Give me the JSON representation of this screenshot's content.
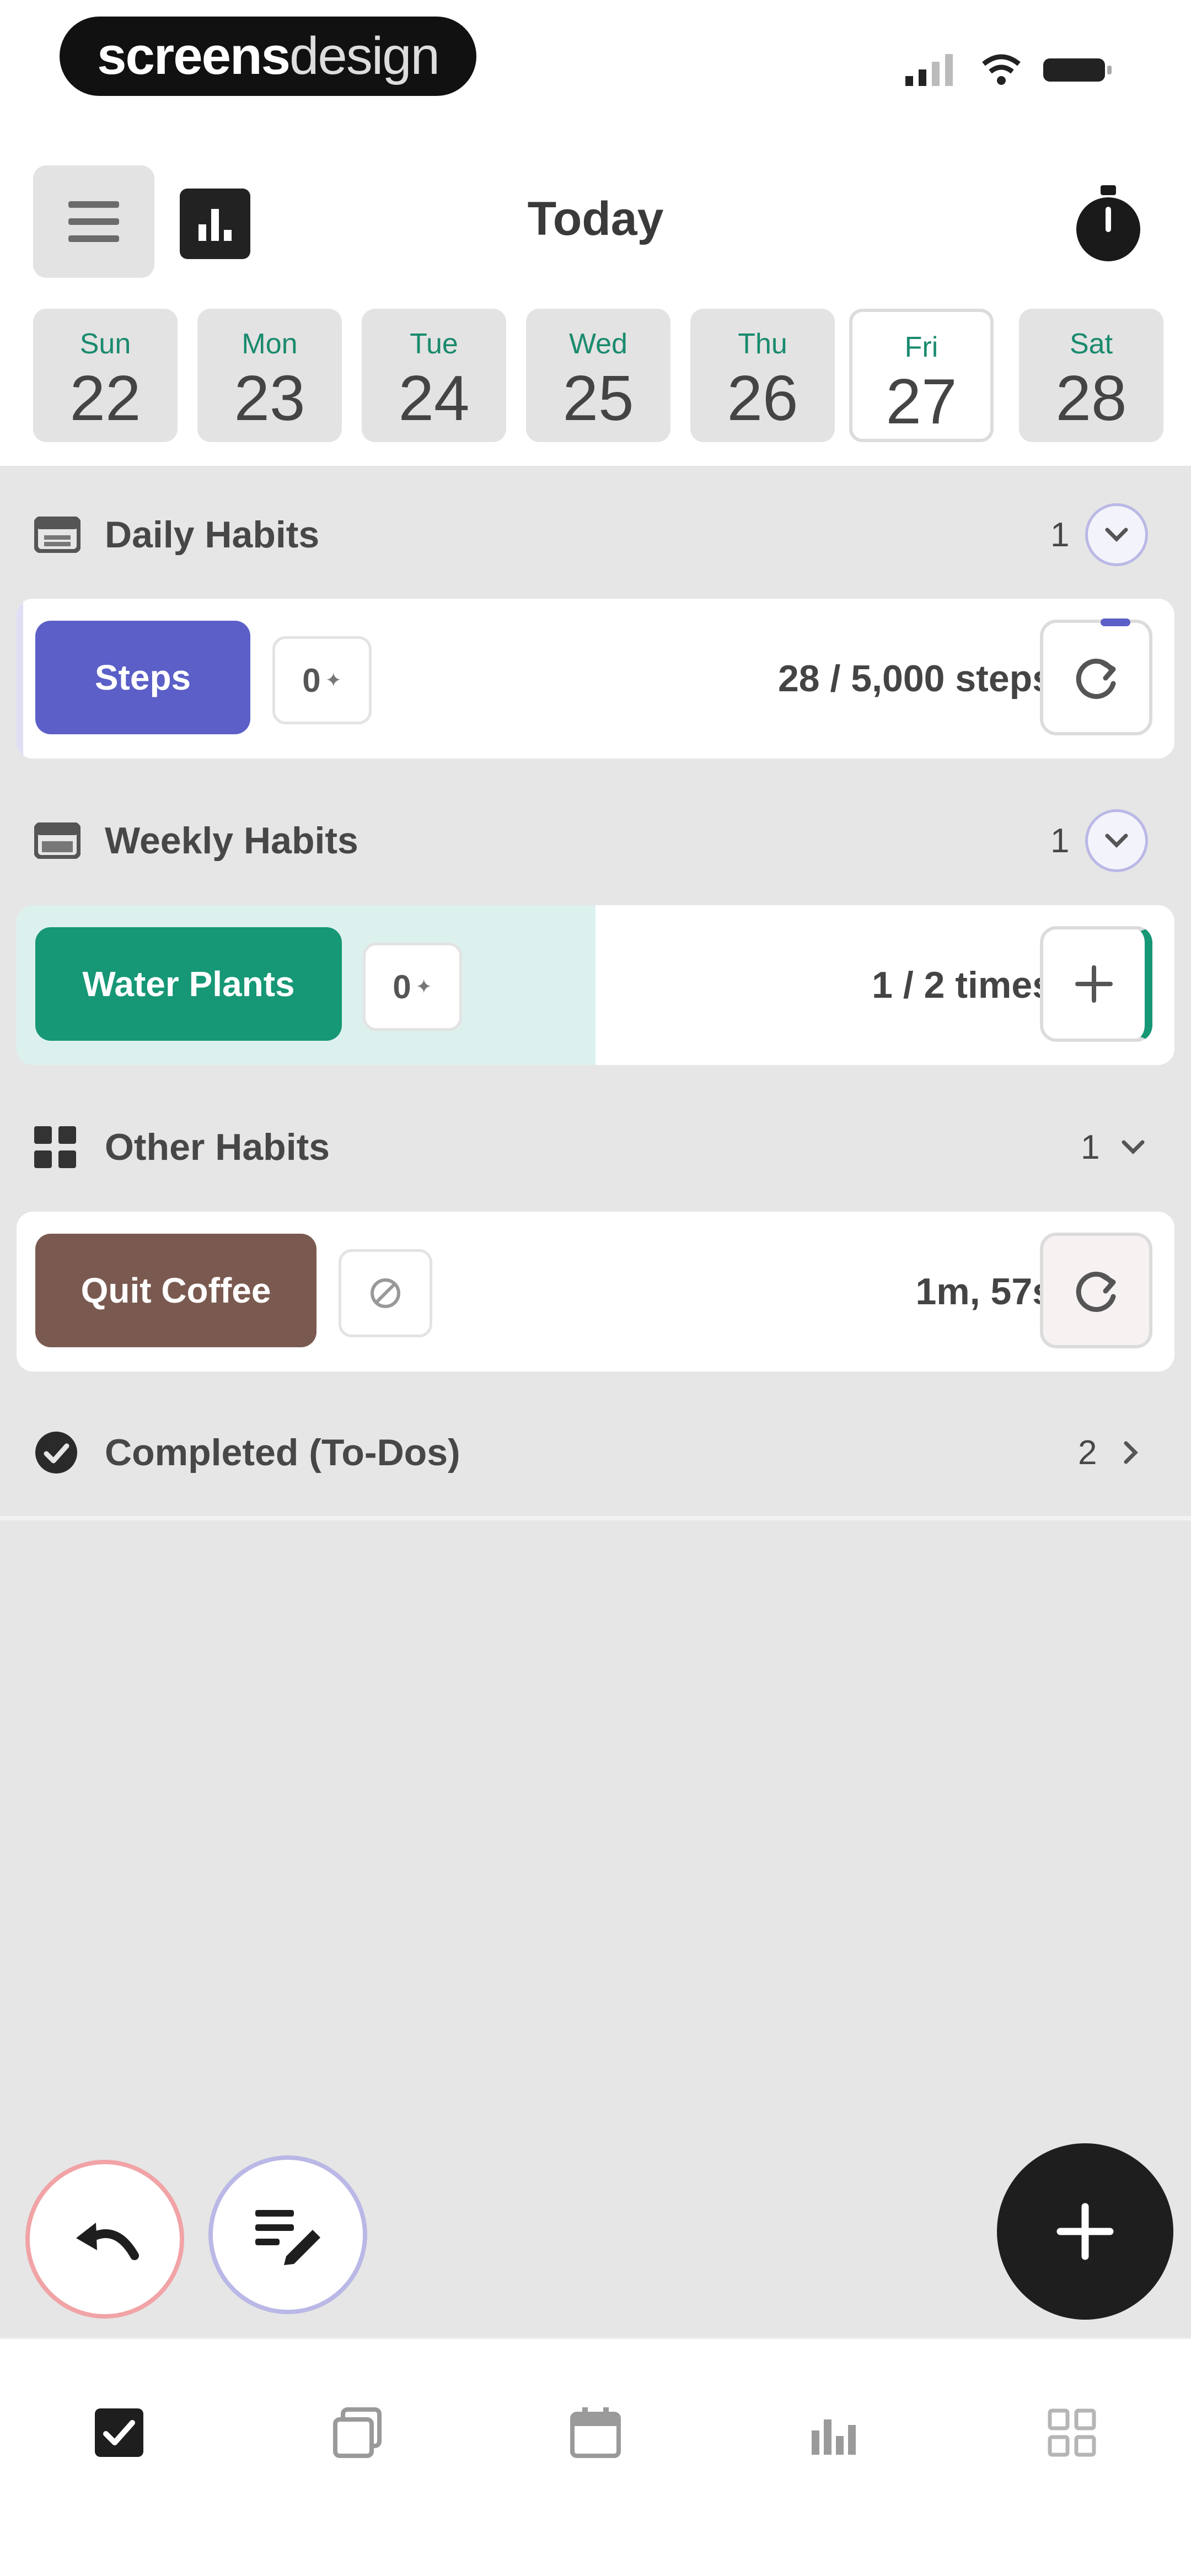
{
  "status_bar": {
    "brand_part1": "screens",
    "brand_part2": "design"
  },
  "header": {
    "title": "Today",
    "menu_icon": "hamburger-menu-icon",
    "stats_icon": "bar-chart-icon",
    "timer_icon": "stopwatch-icon"
  },
  "week": [
    {
      "name": "Sun",
      "date": "22",
      "selected": false
    },
    {
      "name": "Mon",
      "date": "23",
      "selected": false
    },
    {
      "name": "Tue",
      "date": "24",
      "selected": false
    },
    {
      "name": "Wed",
      "date": "25",
      "selected": false
    },
    {
      "name": "Thu",
      "date": "26",
      "selected": false
    },
    {
      "name": "Fri",
      "date": "27",
      "selected": true
    },
    {
      "name": "Sat",
      "date": "28",
      "selected": false
    }
  ],
  "sections": {
    "daily": {
      "label": "Daily Habits",
      "count": "1",
      "habit": {
        "name": "Steps",
        "streak": "0",
        "progress": "28 / 5,000 steps",
        "progress_fraction": 0.0056,
        "color": "#5b5fc7",
        "action_icon": "refresh-icon"
      }
    },
    "weekly": {
      "label": "Weekly Habits",
      "count": "1",
      "habit": {
        "name": "Water Plants",
        "streak": "0",
        "progress": "1 / 2 times",
        "progress_fraction": 0.5,
        "color": "#169776",
        "action_icon": "plus-icon"
      }
    },
    "other": {
      "label": "Other Habits",
      "count": "1",
      "habit": {
        "name": "Quit Coffee",
        "timer": "1m, 57s",
        "color": "#7a5a50",
        "action_icon": "refresh-icon"
      }
    },
    "completed": {
      "label": "Completed (To-Dos)",
      "count": "2"
    }
  },
  "bottom_nav": [
    {
      "name": "nav-today",
      "icon": "checkbox-icon",
      "active": true
    },
    {
      "name": "nav-habits",
      "icon": "stack-icon",
      "active": false
    },
    {
      "name": "nav-calendar",
      "icon": "calendar-icon",
      "active": false
    },
    {
      "name": "nav-stats",
      "icon": "stats-icon",
      "active": false
    },
    {
      "name": "nav-more",
      "icon": "grid-icon",
      "active": false
    }
  ],
  "colors": {
    "accent_green": "#1a8a6e",
    "undo_ring": "#f1a3a6",
    "notes_ring": "#b9b8e6",
    "content_bg": "#e6e6e6"
  }
}
